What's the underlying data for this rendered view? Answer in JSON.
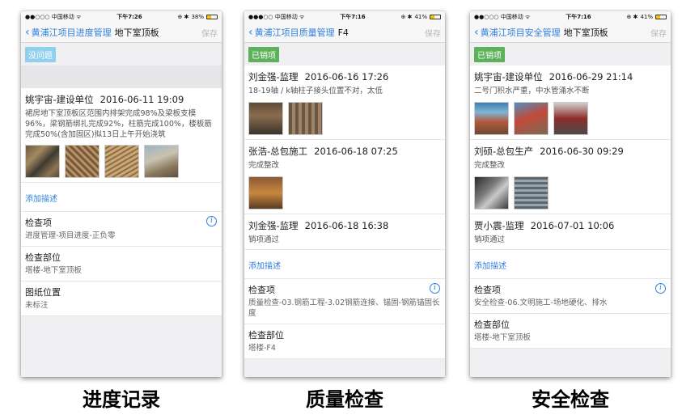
{
  "phones": [
    {
      "status": {
        "carrier": "●●○○○ 中国移动 ᯤ",
        "time": "下午7:26",
        "icons": "⊕ ✱",
        "battery": "38%",
        "battery_level": 0.38
      },
      "nav": {
        "back": "黄浦江项目进度管理",
        "title": "地下室顶板",
        "save": "保存"
      },
      "tag": "没问题",
      "record": {
        "author": "姚宇宙-建设单位",
        "time": "2016-06-11 19:09",
        "text": "裙房地下室顶板区范围内排架完成98%及梁板支模96%，梁钢筋绑扎完成92%，柱筋完成100%，楼板筋完成50%(含加固区)拟13日上午开始浇筑"
      },
      "add_desc": "添加描述",
      "fields": [
        {
          "label": "检查项",
          "value": "进度管理-项目进度-正负零"
        },
        {
          "label": "检查部位",
          "value": "塔楼-地下室顶板"
        },
        {
          "label": "图纸位置",
          "value": "未标注"
        }
      ]
    },
    {
      "status": {
        "carrier": "●●●○○ 中国移动 ᯤ",
        "time": "下午7:16",
        "icons": "⊕ ✱",
        "battery": "41%",
        "battery_level": 0.41
      },
      "nav": {
        "back": "黄浦江项目质量管理",
        "title": "F4",
        "save": "保存"
      },
      "tag": "已销项",
      "records": [
        {
          "author": "刘金强-监理",
          "time": "2016-06-16 17:26",
          "text": "18-19轴 / k轴柱子接头位置不对，太低"
        },
        {
          "author": "张浩-总包施工",
          "time": "2016-06-18 07:25",
          "text": "完成整改"
        },
        {
          "author": "刘金强-监理",
          "time": "2016-06-18 16:38",
          "text": "销项通过"
        }
      ],
      "add_desc": "添加描述",
      "fields": [
        {
          "label": "检查项",
          "value": "质量检查-03.钢筋工程-3.02钢筋连接、锚固-钢筋锚固长度"
        },
        {
          "label": "检查部位",
          "value": "塔楼-F4"
        }
      ]
    },
    {
      "status": {
        "carrier": "●●○○○ 中国移动 ᯤ",
        "time": "下午7:16",
        "icons": "⊕ ✱",
        "battery": "41%",
        "battery_level": 0.41
      },
      "nav": {
        "back": "黄浦江项目安全管理",
        "title": "地下室顶板",
        "save": "保存"
      },
      "tag": "已销项",
      "records": [
        {
          "author": "姚宇宙-建设单位",
          "time": "2016-06-29 21:14",
          "text": "二号门积水严重，中水管涌水不断"
        },
        {
          "author": "刘硕-总包生产",
          "time": "2016-06-30 09:29",
          "text": "完成整改"
        },
        {
          "author": "贾小震-监理",
          "time": "2016-07-01 10:06",
          "text": "销项通过"
        }
      ],
      "add_desc": "添加描述",
      "fields": [
        {
          "label": "检查项",
          "value": "安全检查-06.文明施工-场地硬化、排水"
        },
        {
          "label": "检查部位",
          "value": "塔楼-地下室顶板"
        }
      ]
    }
  ],
  "captions": [
    "进度记录",
    "质量检查",
    "安全检查"
  ],
  "colors": {
    "accent": "#2f7fe0",
    "tag_blue": "#8fd0ec",
    "tag_green": "#5cb15a"
  }
}
